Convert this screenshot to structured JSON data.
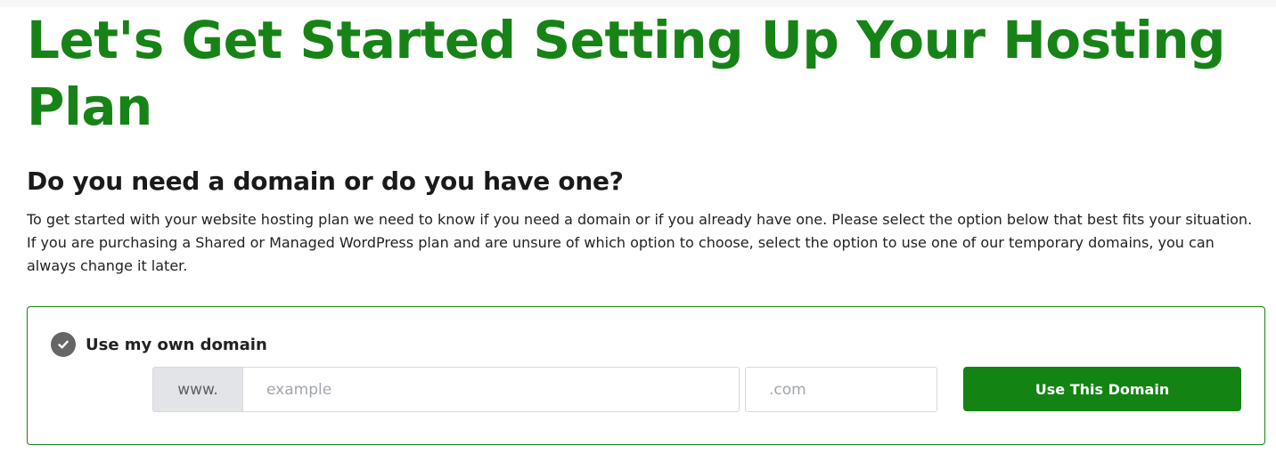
{
  "page": {
    "title": "Let's Get Started Setting Up Your Hosting Plan",
    "subheading": "Do you need a domain or do you have one?",
    "description": "To get started with your website hosting plan we need to know if you need a domain or if you already have one. Please select the option below that best fits your situation. If you are purchasing a Shared or Managed WordPress plan and are unsure of which option to choose, select the option to use one of our temporary domains, you can always change it later."
  },
  "own_domain_option": {
    "label": "Use my own domain",
    "selected": true,
    "check_icon": "check-circle-icon",
    "prefix": "www.",
    "domain_placeholder": "example",
    "domain_value": "",
    "tld_placeholder": ".com",
    "tld_value": "",
    "button_label": "Use This Domain"
  },
  "colors": {
    "brand_green": "#178317",
    "button_green": "#138313",
    "check_gray": "#666666",
    "prefix_bg": "#e2e4e8"
  }
}
